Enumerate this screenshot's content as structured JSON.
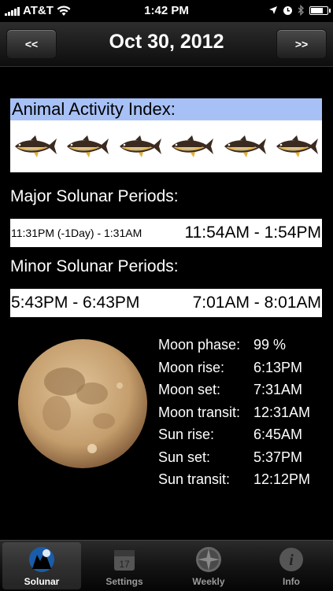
{
  "status": {
    "carrier": "AT&T",
    "time": "1:42 PM"
  },
  "nav": {
    "prev_label": "<<",
    "title": "Oct 30, 2012",
    "next_label": ">>"
  },
  "activity": {
    "title": "Animal Activity Index:",
    "fish_count": 6
  },
  "major": {
    "title": "Major Solunar Periods:",
    "period1": "11:31PM (-1Day) - 1:31AM",
    "period2": "11:54AM - 1:54PM"
  },
  "minor": {
    "title": "Minor Solunar Periods:",
    "period1": "5:43PM - 6:43PM",
    "period2": "7:01AM - 8:01AM"
  },
  "info": {
    "moon_phase_label": "Moon phase:",
    "moon_phase_value": "99 %",
    "moon_rise_label": "Moon rise:",
    "moon_rise_value": "6:13PM",
    "moon_set_label": "Moon set:",
    "moon_set_value": "7:31AM",
    "moon_transit_label": "Moon transit:",
    "moon_transit_value": "12:31AM",
    "sun_rise_label": "Sun rise:",
    "sun_rise_value": "6:45AM",
    "sun_set_label": "Sun set:",
    "sun_set_value": "5:37PM",
    "sun_transit_label": "Sun transit:",
    "sun_transit_value": "12:12PM"
  },
  "tabs": [
    {
      "label": "Solunar",
      "icon": "solunar-icon",
      "active": true
    },
    {
      "label": "Settings",
      "icon": "calendar-icon",
      "active": false
    },
    {
      "label": "Weekly",
      "icon": "compass-icon",
      "active": false
    },
    {
      "label": "Info",
      "icon": "info-icon",
      "active": false
    }
  ],
  "colors": {
    "activity_header_bg": "#a7c1f7",
    "moon": "#c9a679"
  }
}
